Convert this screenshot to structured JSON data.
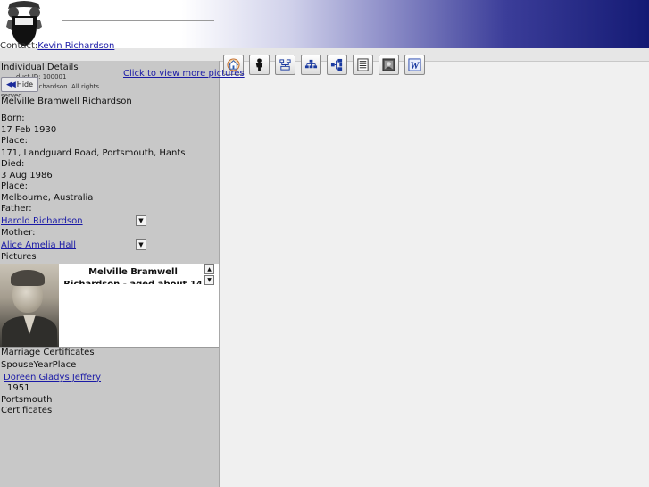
{
  "contact": {
    "label": "Contact:",
    "name": "Kevin Richardson"
  },
  "individual": {
    "section_title": "Individual Details",
    "fine_product": "duct ID: 100001",
    "fine_copyright": "n Richardson. All rights",
    "fine_reserved": "served",
    "name": "Melville Bramwell Richardson",
    "born_label": "Born:",
    "born_date": "17 Feb 1930",
    "born_place_label": "Place:",
    "born_place": "171, Landguard Road, Portsmouth, Hants",
    "died_label": "Died:",
    "died_date": "3 Aug 1986",
    "died_place_label": "Place:",
    "died_place": "Melbourne, Australia",
    "father_label": "Father:",
    "father": "Harold Richardson",
    "mother_label": "Mother:",
    "mother": "Alice Amelia Hall"
  },
  "hide_button": {
    "label": "Hide",
    "icon": "double-left-arrow-icon"
  },
  "more_pictures": "Click to view more pictures",
  "pictures": {
    "section_title": "Pictures",
    "caption": "Melville Bramwell Richardson - aged about 14"
  },
  "marriage": {
    "section_title": "Marriage Certificates",
    "columns_header": "SpouseYearPlace",
    "spouse": "Doreen Gladys Jeffery",
    "year": "1951",
    "place": "Portsmouth",
    "certificates_label": "Certificates"
  },
  "toolbar": {
    "buttons": [
      {
        "name": "home-button",
        "icon": "home-icon"
      },
      {
        "name": "individual-button",
        "icon": "person-icon"
      },
      {
        "name": "family-button",
        "icon": "family-group-icon"
      },
      {
        "name": "descendants-button",
        "icon": "descendant-tree-icon"
      },
      {
        "name": "ancestors-button",
        "icon": "ancestor-tree-icon"
      },
      {
        "name": "report-button",
        "icon": "list-report-icon"
      },
      {
        "name": "photo-button",
        "icon": "photo-icon"
      },
      {
        "name": "word-export-button",
        "icon": "word-document-icon"
      }
    ]
  },
  "colors": {
    "link": "#1a1aa6",
    "panel": "#c8c8c8",
    "banner_dark": "#141a74"
  }
}
